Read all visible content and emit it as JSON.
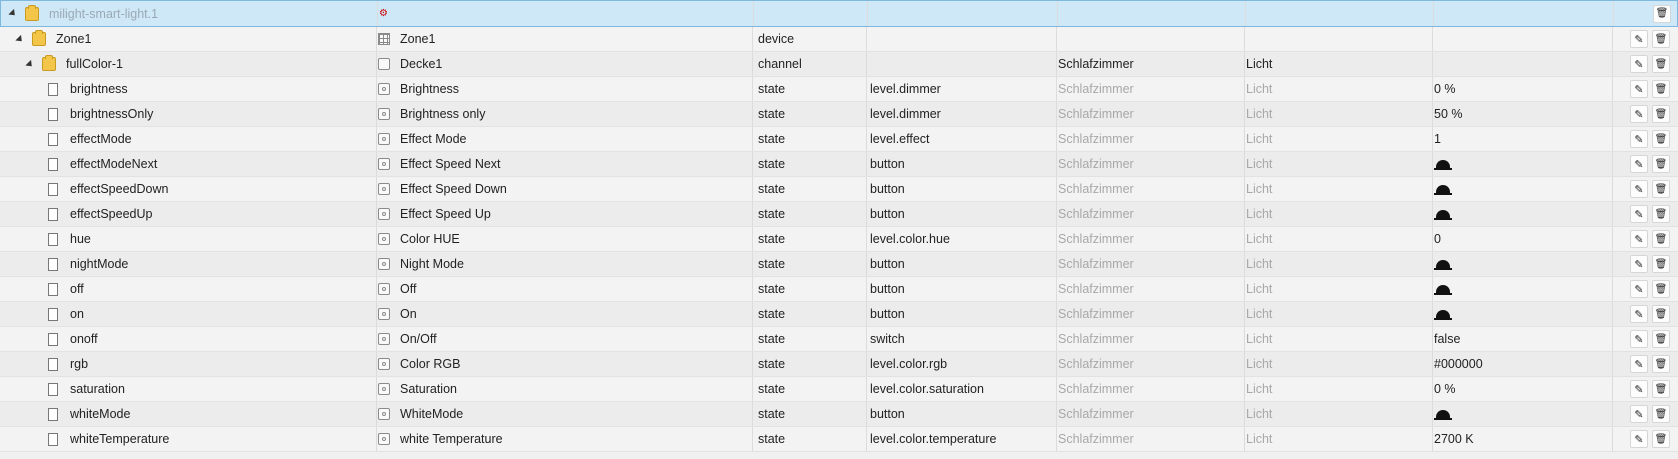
{
  "rows": [
    {
      "name": "milight-smart-light.1",
      "title": "",
      "type": "",
      "role": "",
      "room": "",
      "function": "",
      "value": "",
      "level": 0,
      "icon": "folder-icon",
      "root": true
    },
    {
      "name": "Zone1",
      "title": "Zone1",
      "type": "device",
      "role": "",
      "room": "",
      "function": "",
      "value": "",
      "level": 1,
      "icon": "folder-icon"
    },
    {
      "name": "fullColor-1",
      "title": "Decke1",
      "type": "channel",
      "role": "",
      "room": "Schlafzimmer",
      "function": "Licht",
      "value": "",
      "level": 2,
      "icon": "folder-icon"
    },
    {
      "name": "brightness",
      "title": "Brightness",
      "type": "state",
      "role": "level.dimmer",
      "room": "Schlafzimmer",
      "function": "Licht",
      "value": "0 %",
      "level": 3,
      "icon": "file-icon"
    },
    {
      "name": "brightnessOnly",
      "title": "Brightness only",
      "type": "state",
      "role": "level.dimmer",
      "room": "Schlafzimmer",
      "function": "Licht",
      "value": "50 %",
      "level": 3,
      "icon": "file-icon"
    },
    {
      "name": "effectMode",
      "title": "Effect Mode",
      "type": "state",
      "role": "level.effect",
      "room": "Schlafzimmer",
      "function": "Licht",
      "value": "1",
      "level": 3,
      "icon": "file-icon"
    },
    {
      "name": "effectModeNext",
      "title": "Effect Speed Next",
      "type": "state",
      "role": "button",
      "room": "Schlafzimmer",
      "function": "Licht",
      "value": "",
      "level": 3,
      "icon": "file-icon",
      "button": true
    },
    {
      "name": "effectSpeedDown",
      "title": "Effect Speed Down",
      "type": "state",
      "role": "button",
      "room": "Schlafzimmer",
      "function": "Licht",
      "value": "",
      "level": 3,
      "icon": "file-icon",
      "button": true
    },
    {
      "name": "effectSpeedUp",
      "title": "Effect Speed Up",
      "type": "state",
      "role": "button",
      "room": "Schlafzimmer",
      "function": "Licht",
      "value": "",
      "level": 3,
      "icon": "file-icon",
      "button": true
    },
    {
      "name": "hue",
      "title": "Color HUE",
      "type": "state",
      "role": "level.color.hue",
      "room": "Schlafzimmer",
      "function": "Licht",
      "value": "0",
      "level": 3,
      "icon": "file-icon"
    },
    {
      "name": "nightMode",
      "title": "Night Mode",
      "type": "state",
      "role": "button",
      "room": "Schlafzimmer",
      "function": "Licht",
      "value": "",
      "level": 3,
      "icon": "file-icon",
      "button": true
    },
    {
      "name": "off",
      "title": "Off",
      "type": "state",
      "role": "button",
      "room": "Schlafzimmer",
      "function": "Licht",
      "value": "",
      "level": 3,
      "icon": "file-icon",
      "button": true
    },
    {
      "name": "on",
      "title": "On",
      "type": "state",
      "role": "button",
      "room": "Schlafzimmer",
      "function": "Licht",
      "value": "",
      "level": 3,
      "icon": "file-icon",
      "button": true
    },
    {
      "name": "onoff",
      "title": "On/Off",
      "type": "state",
      "role": "switch",
      "room": "Schlafzimmer",
      "function": "Licht",
      "value": "false",
      "level": 3,
      "icon": "file-icon"
    },
    {
      "name": "rgb",
      "title": "Color RGB",
      "type": "state",
      "role": "level.color.rgb",
      "room": "Schlafzimmer",
      "function": "Licht",
      "value": "#000000",
      "level": 3,
      "icon": "file-icon"
    },
    {
      "name": "saturation",
      "title": "Saturation",
      "type": "state",
      "role": "level.color.saturation",
      "room": "Schlafzimmer",
      "function": "Licht",
      "value": "0 %",
      "level": 3,
      "icon": "file-icon"
    },
    {
      "name": "whiteMode",
      "title": "WhiteMode",
      "type": "state",
      "role": "button",
      "room": "Schlafzimmer",
      "function": "Licht",
      "value": "",
      "level": 3,
      "icon": "file-icon",
      "button": true
    },
    {
      "name": "whiteTemperature",
      "title": "white Temperature",
      "type": "state",
      "role": "level.color.temperature",
      "room": "Schlafzimmer",
      "function": "Licht",
      "value": "2700 K",
      "level": 3,
      "icon": "file-icon"
    }
  ],
  "icons": {
    "edit": "pencil-icon",
    "delete": "trash-icon",
    "button_value": "bell-button-icon"
  }
}
